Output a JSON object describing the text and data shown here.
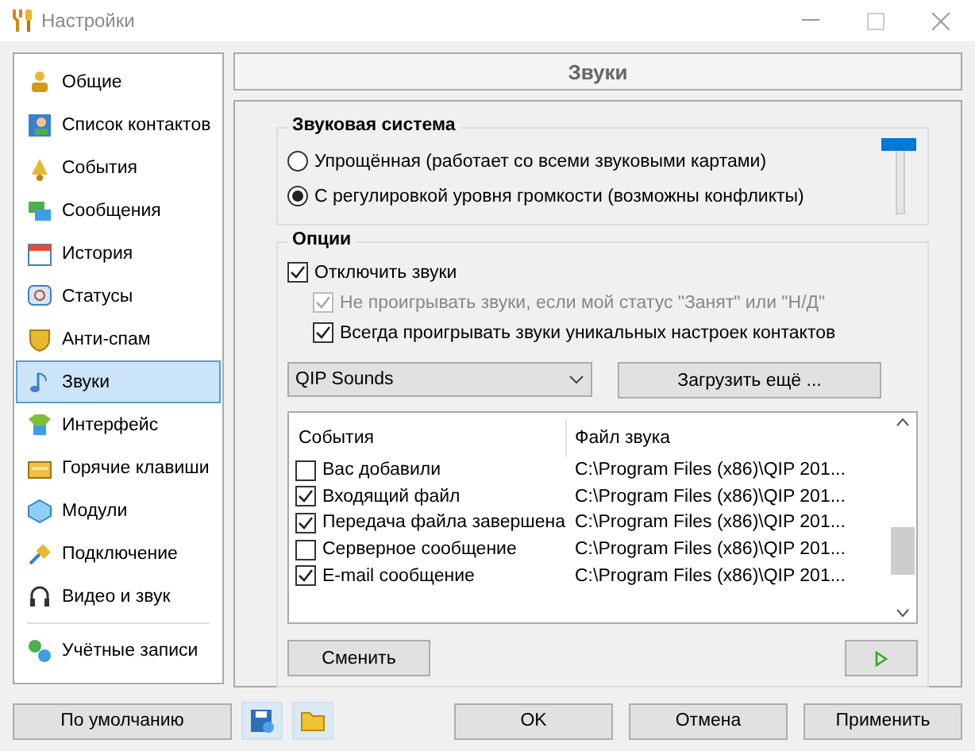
{
  "window": {
    "title": "Настройки"
  },
  "sidebar": {
    "items": [
      {
        "label": "Общие",
        "selected": false
      },
      {
        "label": "Список контактов",
        "selected": false
      },
      {
        "label": "События",
        "selected": false
      },
      {
        "label": "Сообщения",
        "selected": false
      },
      {
        "label": "История",
        "selected": false
      },
      {
        "label": "Статусы",
        "selected": false
      },
      {
        "label": "Анти-спам",
        "selected": false
      },
      {
        "label": "Звуки",
        "selected": true
      },
      {
        "label": "Интерфейс",
        "selected": false
      },
      {
        "label": "Горячие клавиши",
        "selected": false
      },
      {
        "label": "Модули",
        "selected": false
      },
      {
        "label": "Подключение",
        "selected": false
      },
      {
        "label": "Видео и звук",
        "selected": false
      },
      {
        "label": "Учётные записи",
        "selected": false
      }
    ]
  },
  "page_title": "Звуки",
  "sound_system": {
    "title": "Звуковая система",
    "options": [
      {
        "label": "Упрощённая (работает со всеми звуковыми картами)",
        "selected": false
      },
      {
        "label": "С регулировкой уровня громкости (возможны конфликты)",
        "selected": true
      }
    ],
    "volume": {
      "level": 1
    }
  },
  "options": {
    "title": "Опции",
    "checkboxes": [
      {
        "label": "Отключить звуки",
        "checked": true,
        "disabled": false,
        "indent": false
      },
      {
        "label": "Не проигрывать звуки, если мой статус \"Занят\" или \"Н/Д\"",
        "checked": true,
        "disabled": true,
        "indent": true
      },
      {
        "label": "Всегда проигрывать звуки уникальных настроек контактов",
        "checked": true,
        "disabled": false,
        "indent": true
      }
    ],
    "scheme": "QIP Sounds",
    "load_button": "Загрузить ещё ...",
    "table": {
      "columns": [
        "События",
        "Файл звука"
      ],
      "rows": [
        {
          "checked": false,
          "event": "Вас добавили",
          "file": "C:\\Program Files (x86)\\QIP 201..."
        },
        {
          "checked": true,
          "event": "Входящий файл",
          "file": "C:\\Program Files (x86)\\QIP 201..."
        },
        {
          "checked": true,
          "event": "Передача файла завершена",
          "file": "C:\\Program Files (x86)\\QIP 201..."
        },
        {
          "checked": false,
          "event": "Серверное сообщение",
          "file": "C:\\Program Files (x86)\\QIP 201..."
        },
        {
          "checked": true,
          "event": "E-mail сообщение",
          "file": "C:\\Program Files (x86)\\QIP 201..."
        }
      ]
    },
    "change_button": "Сменить"
  },
  "buttons": {
    "default": "По умолчанию",
    "ok": "OK",
    "cancel": "Отмена",
    "apply": "Применить"
  }
}
